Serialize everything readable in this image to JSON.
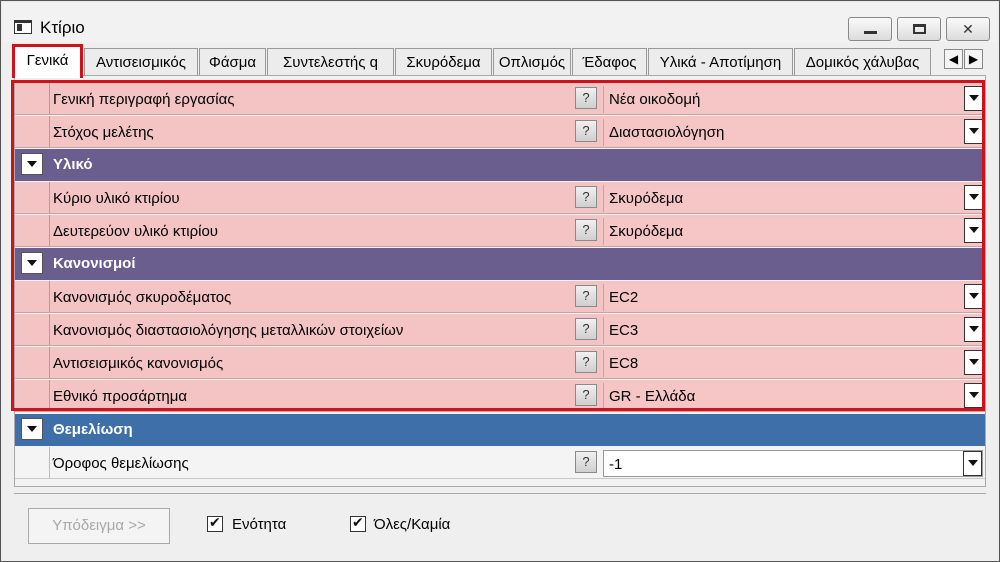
{
  "window": {
    "title": "Κτίριο"
  },
  "tabs": [
    "Γενικά",
    "Αντισεισμικός",
    "Φάσμα",
    "Συντελεστής q",
    "Σκυρόδεμα",
    "Οπλισμός",
    "Έδαφος",
    "Υλικά - Αποτίμηση",
    "Δομικός χάλυβας"
  ],
  "tab_scroll": {
    "left": "◀",
    "right": "▶"
  },
  "grid": {
    "rows": [
      {
        "label": "Γενική περιγραφή εργασίας",
        "help": "?",
        "value": "Νέα οικοδομή"
      },
      {
        "label": "Στόχος μελέτης",
        "help": "?",
        "value": "Διαστασιολόγηση"
      }
    ],
    "categories": [
      {
        "title": "Υλικό",
        "rows": [
          {
            "label": "Κύριο υλικό κτιρίου",
            "help": "?",
            "value": "Σκυρόδεμα"
          },
          {
            "label": "Δευτερεύον υλικό κτιρίου",
            "help": "?",
            "value": "Σκυρόδεμα"
          }
        ]
      },
      {
        "title": "Κανονισμοί",
        "rows": [
          {
            "label": "Κανονισμός σκυροδέματος",
            "help": "?",
            "value": "EC2"
          },
          {
            "label": "Κανονισμός διαστασιολόγησης μεταλλικών στοιχείων",
            "help": "?",
            "value": "EC3"
          },
          {
            "label": "Αντισεισμικός κανονισμός",
            "help": "?",
            "value": "EC8"
          },
          {
            "label": "Εθνικό προσάρτημα",
            "help": "?",
            "value": "GR - Ελλάδα"
          }
        ]
      },
      {
        "title": "Θεμελίωση",
        "rows": [
          {
            "label": "Όροφος θεμελίωσης",
            "help": "?",
            "value": "-1"
          }
        ]
      }
    ]
  },
  "footer": {
    "example_button": "Υπόδειγμα >>",
    "checkbox_unit": "Ενότητα",
    "checkbox_all": "Όλες/Καμία"
  },
  "colors": {
    "highlight": "#d0101a",
    "row_pink": "#f4c3c4",
    "category_purple": "#6a5e8e",
    "category_blue": "#3f6fa9"
  }
}
